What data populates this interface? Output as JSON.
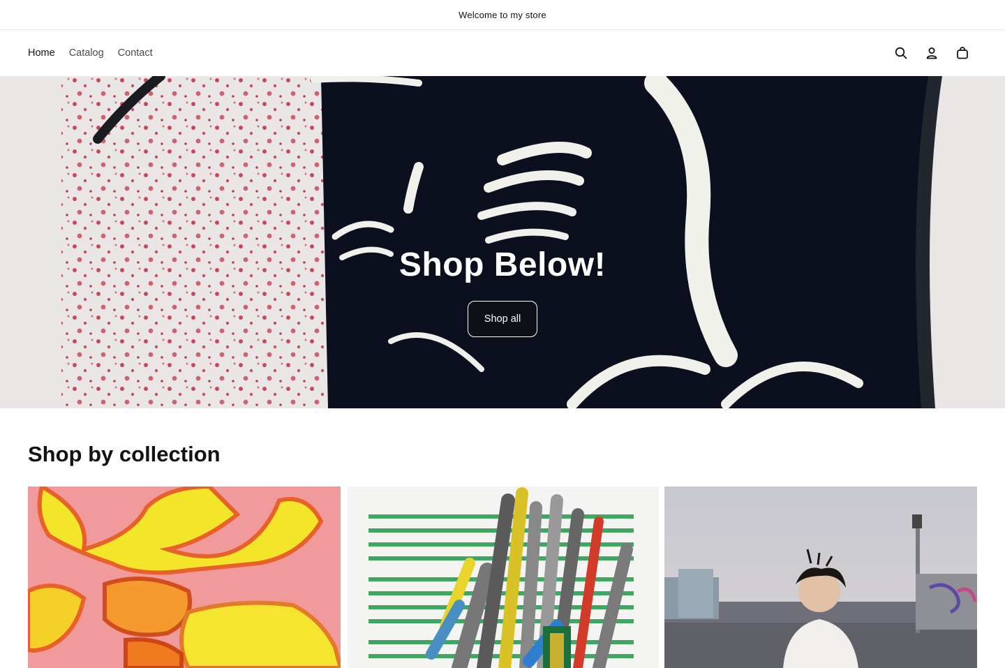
{
  "announcement": {
    "text": "Welcome to my store"
  },
  "nav": {
    "items": [
      {
        "label": "Home"
      },
      {
        "label": "Catalog"
      },
      {
        "label": "Contact"
      }
    ]
  },
  "icons": [
    "search-icon",
    "account-icon",
    "cart-icon"
  ],
  "hero": {
    "title": "Shop Below!",
    "button_label": "Shop all"
  },
  "collections": {
    "heading": "Shop by collection"
  },
  "colors": {
    "text": "#121212",
    "background": "#ffffff",
    "button": "#0e1018"
  }
}
